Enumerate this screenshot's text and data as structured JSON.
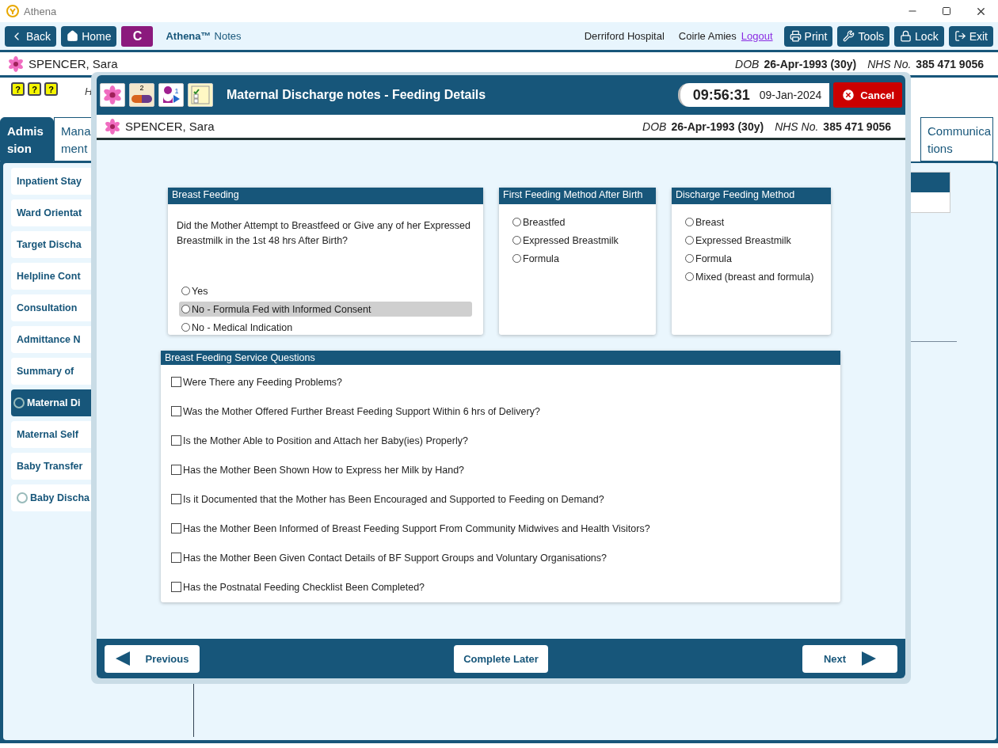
{
  "window": {
    "title": "Athena"
  },
  "toolbar": {
    "nav": [
      {
        "label": "Back",
        "kind": "back"
      },
      {
        "label": "Home",
        "kind": "home"
      }
    ],
    "module_badge": "C",
    "app_name": "Athena™",
    "app_subtitle": "Notes",
    "location": "Derriford Hospital",
    "user": "Coirle Amies",
    "logout": "Logout",
    "actions": [
      {
        "label": "Print",
        "kind": "print"
      },
      {
        "label": "Tools",
        "kind": "tools"
      },
      {
        "label": "Lock",
        "kind": "lock"
      },
      {
        "label": "Exit",
        "kind": "exit"
      }
    ]
  },
  "patient": {
    "name": "SPENCER, Sara",
    "dob_label": "DOB",
    "dob": "26-Apr-1993 (30y)",
    "nhs_label": "NHS No.",
    "nhs": "385 471 9056"
  },
  "alert_icons": [
    {
      "symbol": "?"
    },
    {
      "symbol": "?"
    },
    {
      "symbol": "?"
    }
  ],
  "header_note": "H",
  "tabs": [
    {
      "lines": [
        "Admis",
        "sion"
      ],
      "selected": true
    },
    {
      "lines": [
        "Mana",
        "ment"
      ],
      "selected": false
    },
    {
      "lines": [
        "Communica",
        "tions"
      ],
      "selected": false
    }
  ],
  "sidebar": {
    "items": [
      {
        "label": "Inpatient Stay",
        "selected": false,
        "status": false
      },
      {
        "label": "Ward Orientat",
        "selected": false,
        "status": false
      },
      {
        "label": "Target Discha",
        "selected": false,
        "status": false
      },
      {
        "label": "Helpline Cont",
        "selected": false,
        "status": false
      },
      {
        "label": "Consultation",
        "selected": false,
        "status": false
      },
      {
        "label": "Admittance N",
        "selected": false,
        "status": false
      },
      {
        "label": "Summary of",
        "selected": false,
        "status": false
      },
      {
        "label": "Maternal Di",
        "selected": true,
        "status": true
      },
      {
        "label": "Maternal Self",
        "selected": false,
        "status": false
      },
      {
        "label": "Baby Transfer",
        "selected": false,
        "status": false
      },
      {
        "label": "Baby Discha",
        "selected": false,
        "status": true
      }
    ]
  },
  "dialog": {
    "title": "Maternal Discharge notes - Feeding Details",
    "pill_count": "2",
    "person_count": "1",
    "time": "09:56:31",
    "date": "09-Jan-2024",
    "cancel": "Cancel",
    "patient": {
      "name": "SPENCER, Sara",
      "dob_label": "DOB",
      "dob": "26-Apr-1993 (30y)",
      "nhs_label": "NHS No.",
      "nhs": "385 471 9056"
    },
    "sections": [
      {
        "title": "Breast Feeding",
        "question": "Did the Mother Attempt to Breastfeed or Give any of her Expressed Breastmilk in the 1st 48 hrs After Birth?",
        "options": [
          {
            "label": "Yes",
            "selected": false,
            "highlighted": false
          },
          {
            "label": "No - Formula Fed with Informed Consent",
            "selected": false,
            "highlighted": true
          },
          {
            "label": "No - Medical Indication",
            "selected": false,
            "highlighted": false
          }
        ]
      },
      {
        "title": "First Feeding Method After Birth",
        "options": [
          {
            "label": "Breastfed",
            "selected": false,
            "highlighted": false
          },
          {
            "label": "Expressed Breastmilk",
            "selected": false,
            "highlighted": false
          },
          {
            "label": "Formula",
            "selected": false,
            "highlighted": false
          }
        ]
      },
      {
        "title": "Discharge Feeding Method",
        "options": [
          {
            "label": "Breast",
            "selected": false,
            "highlighted": false
          },
          {
            "label": "Expressed Breastmilk",
            "selected": false,
            "highlighted": false
          },
          {
            "label": "Formula",
            "selected": false,
            "highlighted": false
          },
          {
            "label": "Mixed (breast and formula)",
            "selected": false,
            "highlighted": false
          }
        ]
      }
    ],
    "service_questions": {
      "title": "Breast Feeding Service Questions",
      "items": [
        {
          "label": "Were There any Feeding Problems?",
          "checked": false
        },
        {
          "label": "Was the Mother Offered Further Breast Feeding Support Within 6 hrs of Delivery?",
          "checked": false
        },
        {
          "label": "Is the Mother Able to Position and Attach her Baby(ies) Properly?",
          "checked": false
        },
        {
          "label": "Has the Mother Been Shown How to Express her Milk by Hand?",
          "checked": false
        },
        {
          "label": "Is it Documented that the Mother has Been Encouraged and Supported to Feeding on Demand?",
          "checked": false
        },
        {
          "label": "Has the Mother Been Informed of Breast Feeding Support From Community Midwives and Health Visitors?",
          "checked": false
        },
        {
          "label": "Has the Mother Been Given Contact Details of BF Support Groups and Voluntary Organisations?",
          "checked": false
        },
        {
          "label": "Has the Postnatal Feeding Checklist Been Completed?",
          "checked": false
        }
      ]
    },
    "footer": {
      "previous": "Previous",
      "complete_later": "Complete Later",
      "next": "Next"
    }
  }
}
